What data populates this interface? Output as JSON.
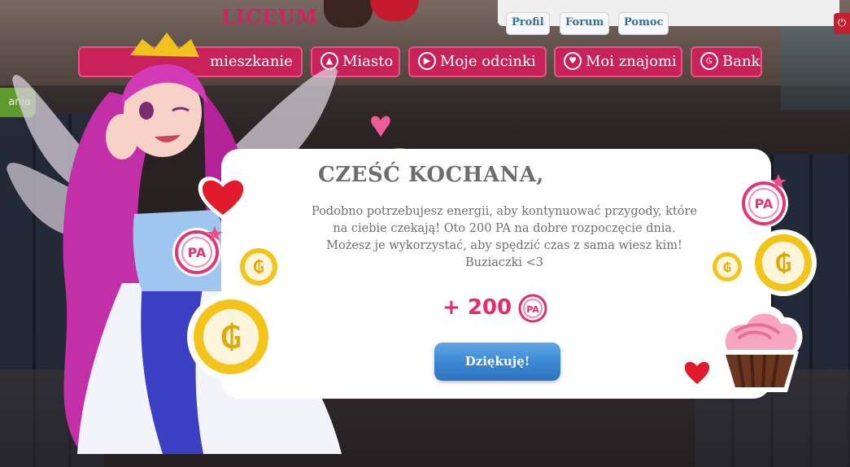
{
  "header": {
    "logo": "LICEUM",
    "top_links": [
      "Profil",
      "Forum",
      "Pomoc"
    ],
    "power_icon": "power-icon",
    "side_pill": "ania"
  },
  "nav": {
    "tabs": [
      {
        "label": "mieszkanie",
        "icon": "home-icon"
      },
      {
        "label": "Miasto",
        "icon": "city-icon"
      },
      {
        "label": "Moje odcinki",
        "icon": "play-icon"
      },
      {
        "label": "Moi znajomi",
        "icon": "heart-icon"
      },
      {
        "label": "Bank",
        "icon": "coin-icon"
      }
    ]
  },
  "dialog": {
    "title": "CZEŚĆ KOCHANA,",
    "message": "Podobno potrzebujesz energii, aby kontynuować przygody, które na ciebie czekają! Oto 200 PA na dobre rozpoczęcie dnia. Możesz je wykorzystać, aby spędzić czas z sama wiesz kim! Buziaczki <3",
    "reward": "+ 200",
    "reward_icon": "pa-token-icon",
    "button_label": "Dziękuję!",
    "pa_icon_text": "PA"
  },
  "colors": {
    "pink": "#e72a6c",
    "nav_pink": "#c9225a",
    "blue": "#3b86d2",
    "gold": "#f0c21b"
  }
}
